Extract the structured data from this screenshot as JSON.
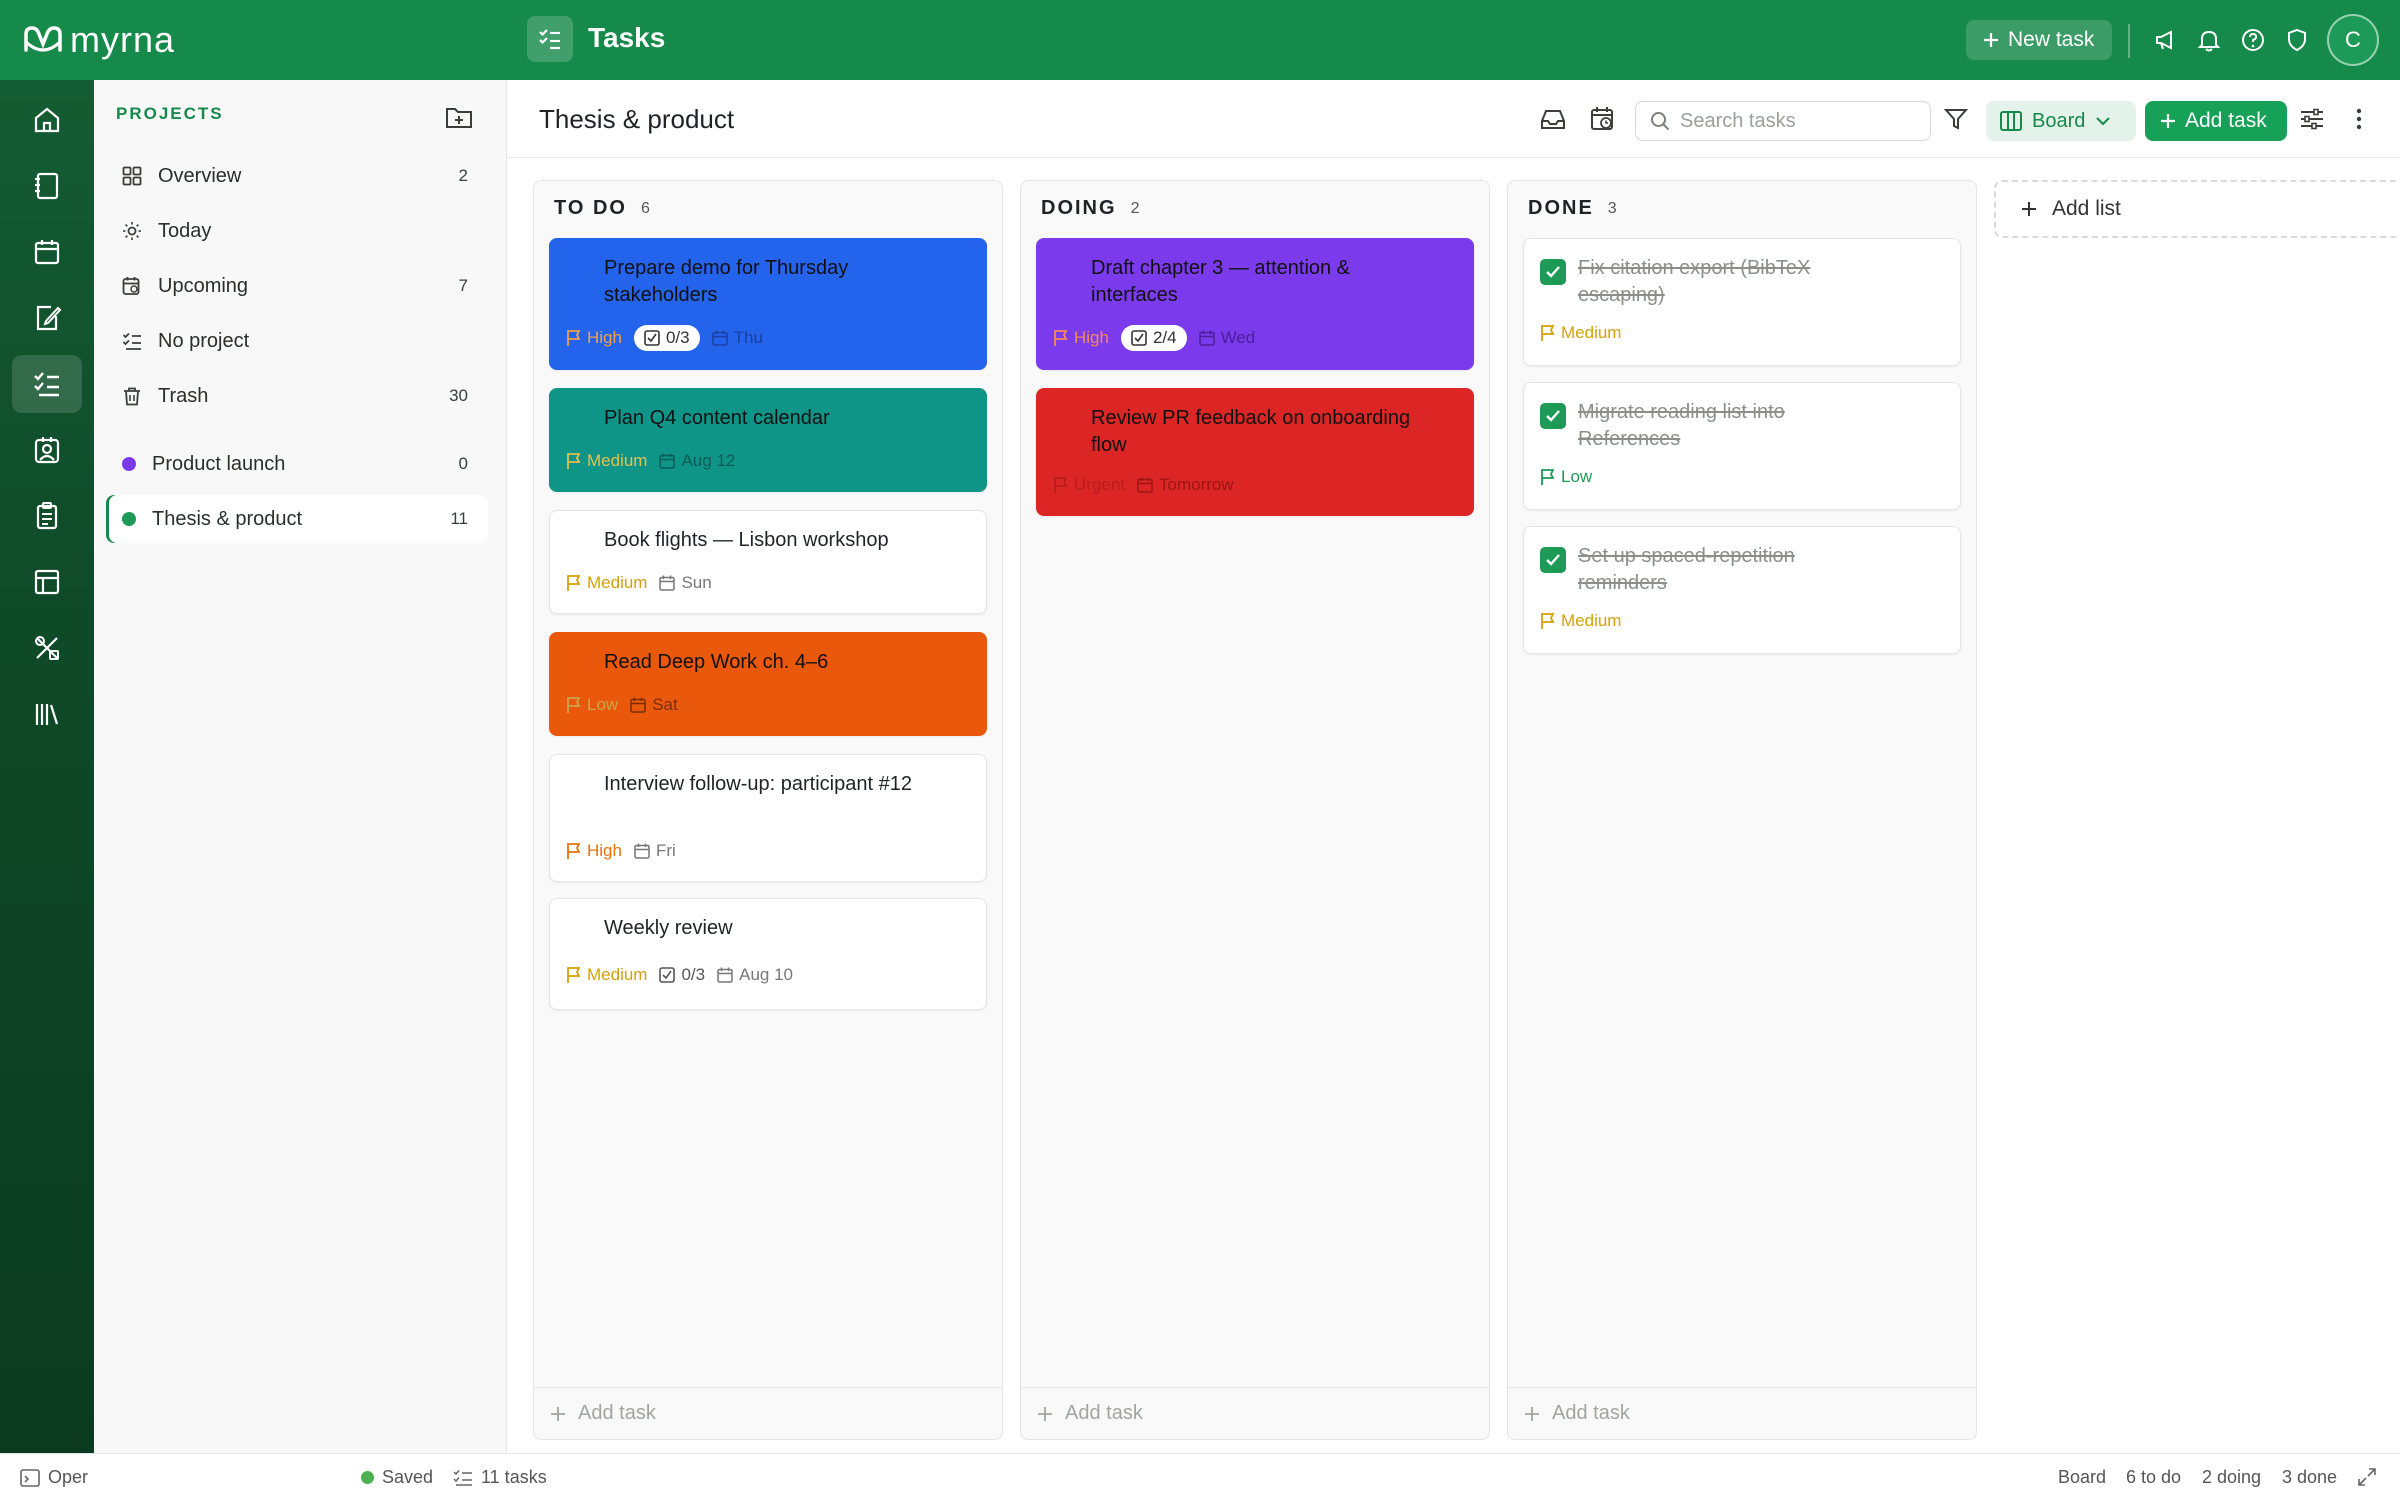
{
  "topbar": {
    "logo_text": "myrna",
    "app_title": "Tasks",
    "new_task_label": "New task",
    "avatar_initial": "C",
    "brand_color": "#168a4a"
  },
  "rail": {
    "items": [
      "home-icon",
      "notebook-icon",
      "calendar-icon",
      "edit-note-icon",
      "tasks-icon",
      "contacts-icon",
      "clipboard-icon",
      "table-icon",
      "tools-icon",
      "library-icon"
    ],
    "active": "tasks-icon"
  },
  "sidebar": {
    "header": "PROJECTS",
    "items": [
      {
        "label": "Overview",
        "count": "2",
        "icon": "grid-icon"
      },
      {
        "label": "Today",
        "count": "",
        "icon": "sun-icon"
      },
      {
        "label": "Upcoming",
        "count": "7",
        "icon": "calendar-clock-icon"
      },
      {
        "label": "No project",
        "count": "",
        "icon": "list-check-icon"
      },
      {
        "label": "Trash",
        "count": "30",
        "icon": "trash-icon"
      }
    ],
    "projects": [
      {
        "label": "Product launch",
        "count": "0",
        "color": "#7c3aed"
      },
      {
        "label": "Thesis & product",
        "count": "11",
        "color": "#1d9a57"
      }
    ]
  },
  "main": {
    "title": "Thesis & product",
    "search_placeholder": "Search tasks",
    "view_label": "Board",
    "add_task_label": "Add task",
    "add_list_label": "Add list",
    "columns": [
      {
        "title": "TO DO",
        "count": "6",
        "footer": "Add task",
        "cards": [
          {
            "title": "Prepare demo for Thursday stakeholders",
            "priority": "High",
            "checklist": "0/3",
            "date": "Thu",
            "color": "#2463eb"
          },
          {
            "title": "Plan Q4 content calendar",
            "priority": "Medium",
            "checklist": "",
            "date": "Aug 12",
            "color": "#0f9488"
          },
          {
            "title": "Book flights — Lisbon workshop",
            "priority": "Medium",
            "checklist": "",
            "date": "Sun",
            "color": ""
          },
          {
            "title": "Read Deep Work ch. 4–6",
            "priority": "Low",
            "checklist": "",
            "date": "Sat",
            "color": "#ea580c"
          },
          {
            "title": "Interview follow-up: participant #12",
            "priority": "High",
            "checklist": "",
            "date": "Fri",
            "color": ""
          },
          {
            "title": "Weekly review",
            "priority": "Medium",
            "checklist": "0/3",
            "date": "Aug 10",
            "color": ""
          }
        ]
      },
      {
        "title": "DOING",
        "count": "2",
        "footer": "Add task",
        "cards": [
          {
            "title": "Draft chapter 3 — attention & interfaces",
            "priority": "High",
            "checklist": "2/4",
            "date": "Wed",
            "color": "#7c3aed"
          },
          {
            "title": "Review PR feedback on onboarding flow",
            "priority": "Urgent",
            "checklist": "",
            "date": "Tomorrow",
            "color": "#dc2626"
          }
        ]
      },
      {
        "title": "DONE",
        "count": "3",
        "footer": "Add task",
        "cards": [
          {
            "title": "Fix citation export (BibTeX escaping)",
            "priority": "Medium"
          },
          {
            "title": "Migrate reading list into References",
            "priority": "Low"
          },
          {
            "title": "Set up spaced-repetition reminders",
            "priority": "Medium"
          }
        ]
      }
    ]
  },
  "statusbar": {
    "left_label": "Oper",
    "saved": "Saved",
    "tasks": "11 tasks",
    "view": "Board",
    "todo": "6 to do",
    "doing": "2 doing",
    "done": "3 done"
  },
  "colors": {
    "high": "#e8730c",
    "medium": "#d4a106",
    "low": "#1d9a57",
    "urgent": "#dc2626"
  }
}
